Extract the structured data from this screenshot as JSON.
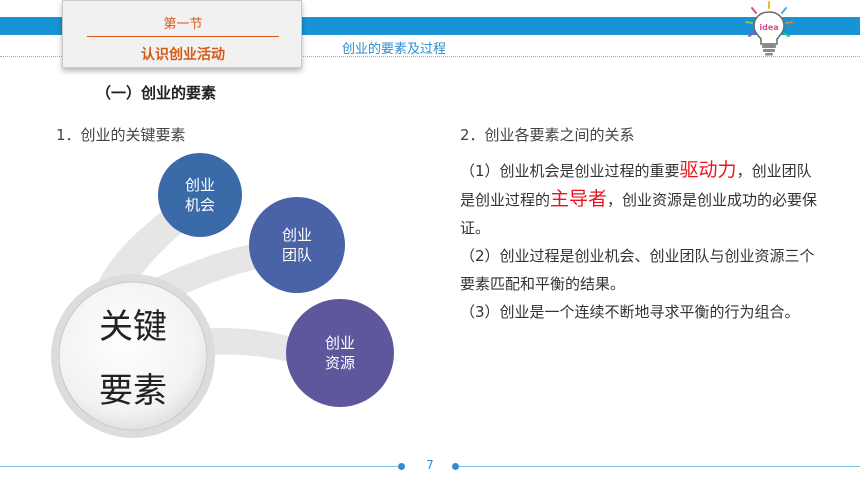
{
  "header": {
    "section_number": "第一节",
    "section_name": "认识创业活动",
    "subtitle": "创业的要素及过程",
    "bulb_badge": "idea"
  },
  "part_heading": "（一）创业的要素",
  "left": {
    "title": "1．创业的关键要素",
    "center_line1": "关键",
    "center_line2": "要素",
    "nodes": [
      {
        "line1": "创业",
        "line2": "机会",
        "color": "#3a6aa8"
      },
      {
        "line1": "创业",
        "line2": "团队",
        "color": "#4a62a6"
      },
      {
        "line1": "创业",
        "line2": "资源",
        "color": "#5f579c"
      }
    ]
  },
  "right": {
    "title": "2．创业各要素之间的关系",
    "p1_a": "（1）创业机会是创业过程的重要",
    "p1_hl1": "驱动力",
    "p1_b": "，创业团队是创业过程的",
    "p1_hl2": "主导者",
    "p1_c": "，创业资源是创业成功的必要保证。",
    "p2": "（2）创业过程是创业机会、创业团队与创业资源三个要素匹配和平衡的结果。",
    "p3": "（3）创业是一个连续不断地寻求平衡的行为组合。"
  },
  "footer": {
    "page_number": "7"
  },
  "colors": {
    "band": "#1793d6",
    "accent_orange": "#d65a17",
    "highlight_red": "#e8141d",
    "accent_blue": "#2b8fd3"
  }
}
